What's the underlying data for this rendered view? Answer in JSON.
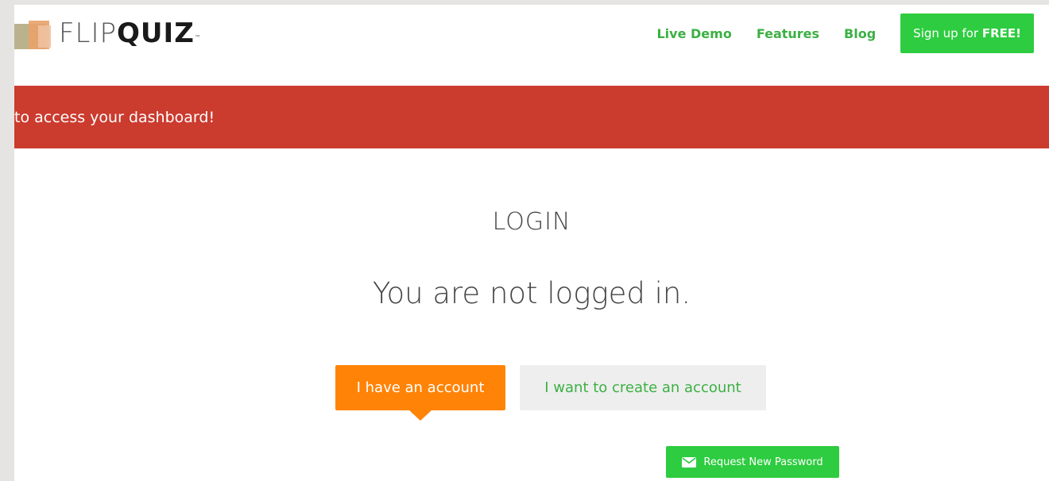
{
  "brand": {
    "part1": "FLIP",
    "part2": "QUIZ",
    "tm": "™"
  },
  "nav": {
    "links": [
      {
        "label": "Live Demo"
      },
      {
        "label": "Features"
      },
      {
        "label": "Blog"
      }
    ],
    "signup": {
      "prefix": "Sign up for ",
      "emphasis": "FREE!"
    }
  },
  "alert": {
    "text": "to access your dashboard!"
  },
  "main": {
    "title": "LOGIN",
    "status": "You are not logged in.",
    "have_account_label": "I have an account",
    "create_account_label": "I want to create an account",
    "reset_label": "Request New Password"
  },
  "colors": {
    "brand_green": "#2ecc40",
    "link_green": "#3cb043",
    "alert_red": "#cb3b2e",
    "orange": "#ff8307"
  },
  "icons": {
    "reset": "envelope-icon"
  }
}
